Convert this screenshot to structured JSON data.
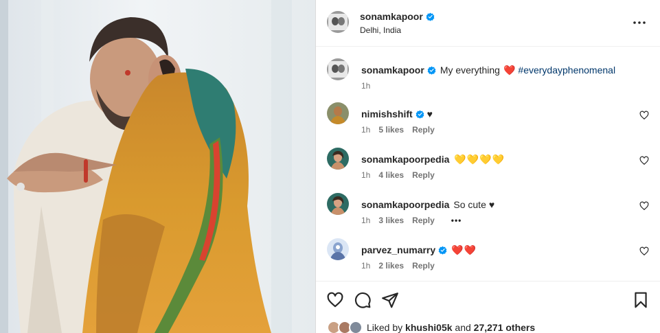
{
  "post": {
    "author": "sonamkapoor",
    "location": "Delhi, India",
    "caption": {
      "user": "sonamkapoor",
      "text": "My everything",
      "emoji": "❤️",
      "hashtag": "#everydayphenomenal",
      "time": "1h"
    }
  },
  "comments": [
    {
      "user": "nimishshift",
      "verified": true,
      "text": "",
      "emoji": "♥",
      "time": "1h",
      "likes": "5 likes",
      "reply": "Reply"
    },
    {
      "user": "sonamkapoorpedia",
      "verified": false,
      "text": "",
      "emoji": "💛💛💛💛",
      "time": "1h",
      "likes": "4 likes",
      "reply": "Reply"
    },
    {
      "user": "sonamkapoorpedia",
      "verified": false,
      "text": "So cute",
      "emoji": "♥",
      "time": "1h",
      "likes": "3 likes",
      "reply": "Reply",
      "more": "•••"
    },
    {
      "user": "parvez_numarry",
      "verified": true,
      "text": "",
      "emoji": "❤️❤️",
      "time": "1h",
      "likes": "2 likes",
      "reply": "Reply"
    }
  ],
  "likes_summary": {
    "prefix": "Liked by",
    "user": "khushi05k",
    "and": "and",
    "others": "27,271 others"
  },
  "icons": {
    "more": "more-horizontal-icon",
    "like": "heart-outline-icon",
    "comment": "comment-bubble-icon",
    "share": "send-paper-plane-icon",
    "save": "bookmark-icon",
    "verified": "verified-badge-icon"
  },
  "colors": {
    "verified_blue": "#0095f6",
    "hashtag": "#00376b",
    "heart_red": "#ed1c24",
    "heart_yellow": "#ffd200"
  }
}
